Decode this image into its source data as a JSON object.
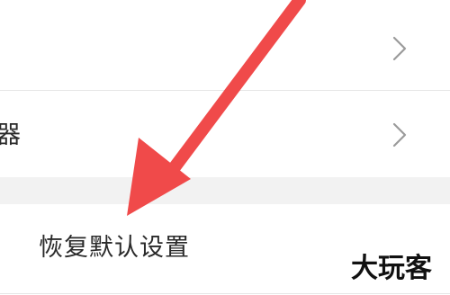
{
  "settings": {
    "middle_row_label": "器",
    "reset_label": "恢复默认设置"
  },
  "icons": {
    "chevron": "chevron-right-icon",
    "annotation_arrow": "arrow-icon"
  },
  "colors": {
    "background": "#ffffff",
    "section_gap": "#f2f2f2",
    "divider": "#e6e6e6",
    "text": "#2a2a2a",
    "chevron": "#9a9a9a",
    "arrow": "#f04a4a"
  },
  "watermark": "大玩客"
}
